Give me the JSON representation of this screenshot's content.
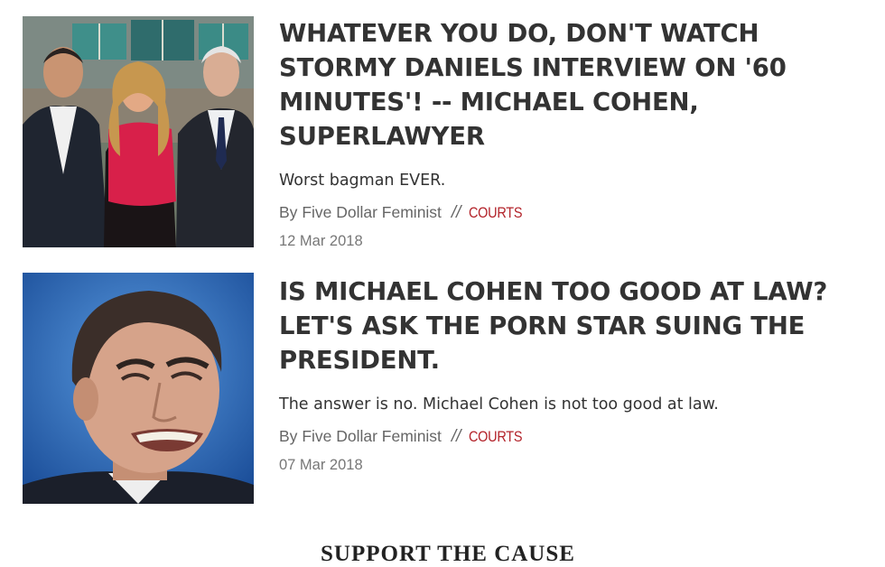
{
  "articles": [
    {
      "headline": "WHATEVER YOU DO, DON'T WATCH STORMY DANIELS INTERVIEW ON '60 MINUTES'! -- MICHAEL COHEN, SUPERLAWYER",
      "excerpt": "Worst bagman EVER.",
      "by": "By",
      "author": "Five Dollar Feminist",
      "separator": "//",
      "category": "COURTS",
      "date": "12 Mar 2018",
      "image_alt": "photo-three-people-studio"
    },
    {
      "headline": "IS MICHAEL COHEN TOO GOOD AT LAW? LET'S ASK THE PORN STAR SUING THE PRESIDENT.",
      "excerpt": "The answer is no. Michael Cohen is not too good at law.",
      "by": "By",
      "author": "Five Dollar Feminist",
      "separator": "//",
      "category": "COURTS",
      "date": "07 Mar 2018",
      "image_alt": "photo-man-grimacing-closeup"
    }
  ],
  "footer_peek": {
    "heading": "SUPPORT THE CAUSE"
  },
  "colors": {
    "category": "#b3232a",
    "headline": "#333333",
    "meta": "#666666"
  }
}
